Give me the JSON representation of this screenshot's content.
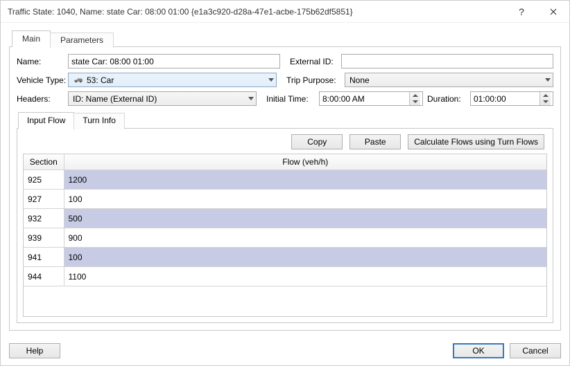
{
  "title": "Traffic State: 1040, Name: state Car: 08:00 01:00  {e1a3c920-d28a-47e1-acbe-175b62df5851}",
  "top_tabs": {
    "main": "Main",
    "parameters": "Parameters"
  },
  "form": {
    "name_label": "Name:",
    "name_value": "state Car: 08:00 01:00",
    "external_id_label": "External ID:",
    "external_id_value": "",
    "vehicle_type_label": "Vehicle Type:",
    "vehicle_type_value": "53: Car",
    "trip_purpose_label": "Trip Purpose:",
    "trip_purpose_value": "None",
    "headers_label": "Headers:",
    "headers_value": "ID: Name (External ID)",
    "initial_time_label": "Initial Time:",
    "initial_time_value": "8:00:00 AM",
    "duration_label": "Duration:",
    "duration_value": "01:00:00"
  },
  "sub_tabs": {
    "input_flow": "Input Flow",
    "turn_info": "Turn Info"
  },
  "actions": {
    "copy": "Copy",
    "paste": "Paste",
    "calc": "Calculate Flows using Turn Flows"
  },
  "table": {
    "col_section": "Section",
    "col_flow": "Flow (veh/h)",
    "rows": [
      {
        "section": "925",
        "flow": "1200"
      },
      {
        "section": "927",
        "flow": "100"
      },
      {
        "section": "932",
        "flow": "500"
      },
      {
        "section": "939",
        "flow": "900"
      },
      {
        "section": "941",
        "flow": "100"
      },
      {
        "section": "944",
        "flow": "1100"
      }
    ]
  },
  "footer": {
    "help": "Help",
    "ok": "OK",
    "cancel": "Cancel"
  },
  "chart_data": {
    "type": "table",
    "title": "Input Flow",
    "columns": [
      "Section",
      "Flow (veh/h)"
    ],
    "rows": [
      [
        "925",
        1200
      ],
      [
        "927",
        100
      ],
      [
        "932",
        500
      ],
      [
        "939",
        900
      ],
      [
        "941",
        100
      ],
      [
        "944",
        1100
      ]
    ]
  }
}
